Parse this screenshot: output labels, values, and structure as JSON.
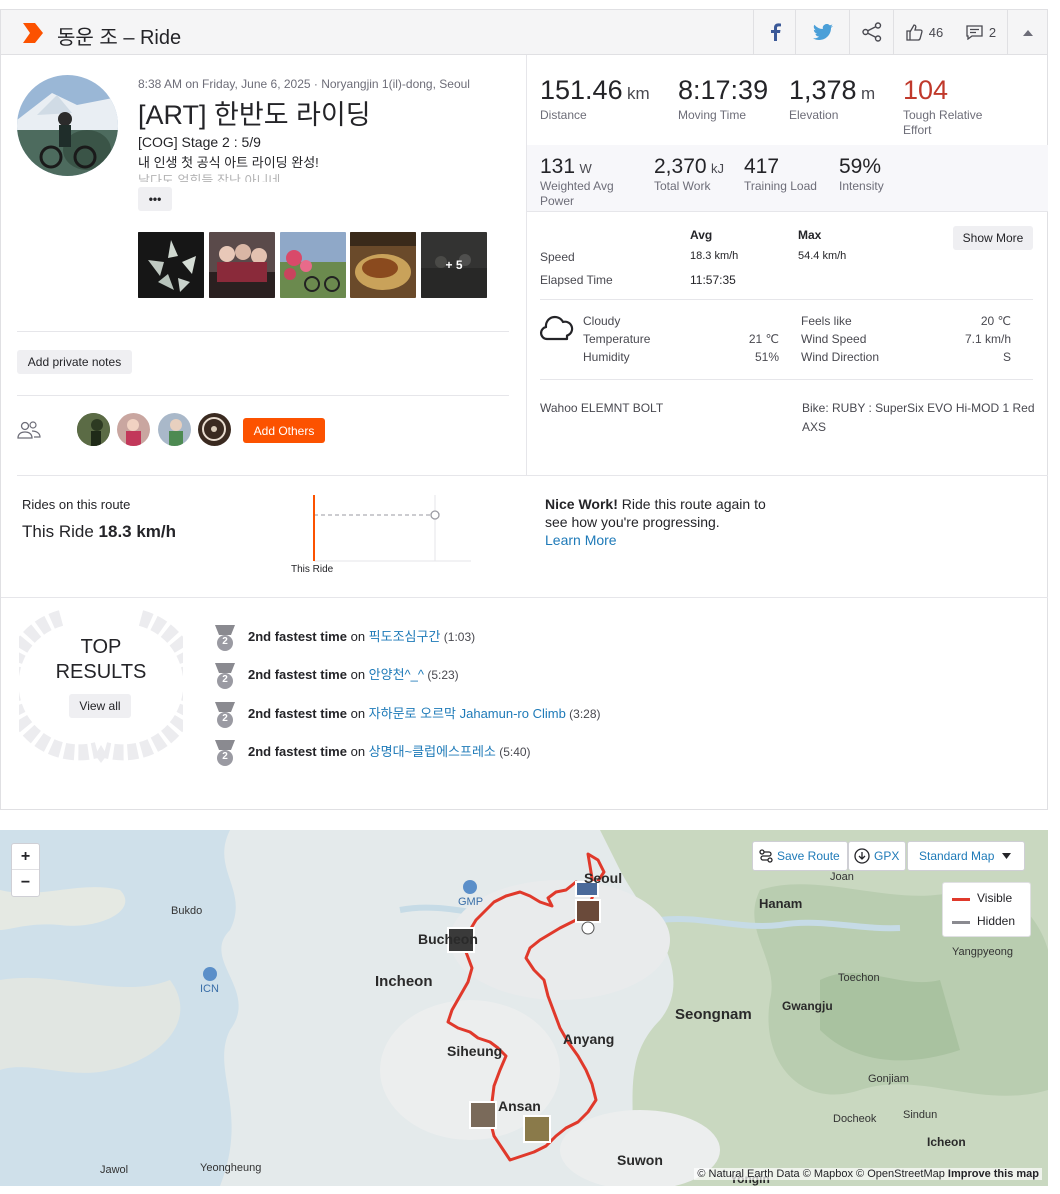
{
  "header": {
    "title": "동운 조 – Ride",
    "kudos_count": "46",
    "comment_count": "2"
  },
  "activity": {
    "datetime_location": "8:38 AM on Friday, June 6, 2025 · Noryangjin 1(il)-dong, Seoul",
    "title": "[ART] 한반도 라이딩",
    "desc_line1": "[COG] Stage 2 : 5/9",
    "desc_line2": "내 인생 첫 공식 아트 라이딩 완성!",
    "desc_line3": "날다도 얼힘들 잡난 아니네",
    "more_label": "•••",
    "photos_more": "+ 5",
    "private_notes_label": "Add private notes",
    "add_others_label": "Add Others"
  },
  "stats_primary": [
    {
      "value": "151.46",
      "unit": "km",
      "label": "Distance"
    },
    {
      "value": "8:17:39",
      "unit": "",
      "label": "Moving Time"
    },
    {
      "value": "1,378",
      "unit": "m",
      "label": "Elevation"
    },
    {
      "value": "104",
      "unit": "",
      "label": "Tough Relative Effort"
    }
  ],
  "stats_secondary": [
    {
      "value": "131",
      "unit": "W",
      "label": "Weighted Avg Power"
    },
    {
      "value": "2,370",
      "unit": "kJ",
      "label": "Total Work"
    },
    {
      "value": "417",
      "unit": "",
      "label": "Training Load"
    },
    {
      "value": "59%",
      "unit": "",
      "label": "Intensity"
    }
  ],
  "details": {
    "avg_header": "Avg",
    "max_header": "Max",
    "show_more_label": "Show More",
    "speed_label": "Speed",
    "speed_avg": "18.3 km/h",
    "speed_max": "54.4 km/h",
    "elapsed_label": "Elapsed Time",
    "elapsed_value": "11:57:35"
  },
  "weather": {
    "condition": "Cloudy",
    "temperature_label": "Temperature",
    "temperature_value": "21 ℃",
    "humidity_label": "Humidity",
    "humidity_value": "51%",
    "feels_like_label": "Feels like",
    "feels_like_value": "20 ℃",
    "wind_speed_label": "Wind Speed",
    "wind_speed_value": "7.1 km/h",
    "wind_direction_label": "Wind Direction",
    "wind_direction_value": "S"
  },
  "gear": {
    "device": "Wahoo ELEMNT BOLT",
    "bike_line1": "Bike: RUBY : SuperSix EVO Hi-MOD 1 Red",
    "bike_line2": "AXS"
  },
  "route": {
    "heading": "Rides on this route",
    "this_ride_prefix": "This Ride",
    "this_ride_value": "18.3 km/h",
    "chart_caption": "This Ride",
    "nice_work_bold": "Nice Work!",
    "nice_work_line1": " Ride this route again to",
    "nice_work_line2": "see how you're progressing.",
    "learn_more": "Learn More"
  },
  "top_results": {
    "line1": "TOP",
    "line2": "RESULTS",
    "view_all": "View all",
    "items": [
      {
        "rank": "2",
        "bold": "2nd fastest time",
        "on": " on ",
        "segment": "픽도조심구간",
        "time": " (1:03)"
      },
      {
        "rank": "2",
        "bold": "2nd fastest time",
        "on": " on ",
        "segment": "안양천^_^",
        "time": " (5:23)"
      },
      {
        "rank": "2",
        "bold": "2nd fastest time",
        "on": " on ",
        "segment": "자하문로 오르막 Jahamun-ro Climb",
        "time": " (3:28)"
      },
      {
        "rank": "2",
        "bold": "2nd fastest time",
        "on": " on ",
        "segment": "상명대~클럽에스프레소",
        "time": " (5:40)"
      }
    ]
  },
  "map": {
    "zoom_in": "+",
    "zoom_out": "−",
    "save_route": "Save Route",
    "gpx": "GPX",
    "map_style": "Standard Map",
    "legend_visible": "Visible",
    "legend_hidden": "Hidden",
    "attribution": "© Natural Earth Data © Mapbox © OpenStreetMap",
    "improve": "Improve this map",
    "places": {
      "seoul": "Seoul",
      "bucheon": "Bucheon",
      "incheon": "Incheon",
      "siheung": "Siheung",
      "anyang": "Anyang",
      "seongnam": "Seongnam",
      "ansan": "Ansan",
      "suwon": "Suwon",
      "hanam": "Hanam",
      "gwangju": "Gwangju",
      "bukdo": "Bukdo",
      "gmp": "GMP",
      "icn": "ICN",
      "joan": "Joan",
      "yangpyeong": "Yangpyeong",
      "toechon": "Toechon",
      "gonjiam": "Gonjiam",
      "docheok": "Docheok",
      "sindun": "Sindun",
      "icheon": "Icheon",
      "jawol": "Jawol",
      "yeongheung": "Yeongheung",
      "yongin": "Yongin"
    }
  },
  "colors": {
    "brand": "#fc5200",
    "effort": "#c0392b",
    "link": "#1e7ab8",
    "route": "#e0392b"
  }
}
